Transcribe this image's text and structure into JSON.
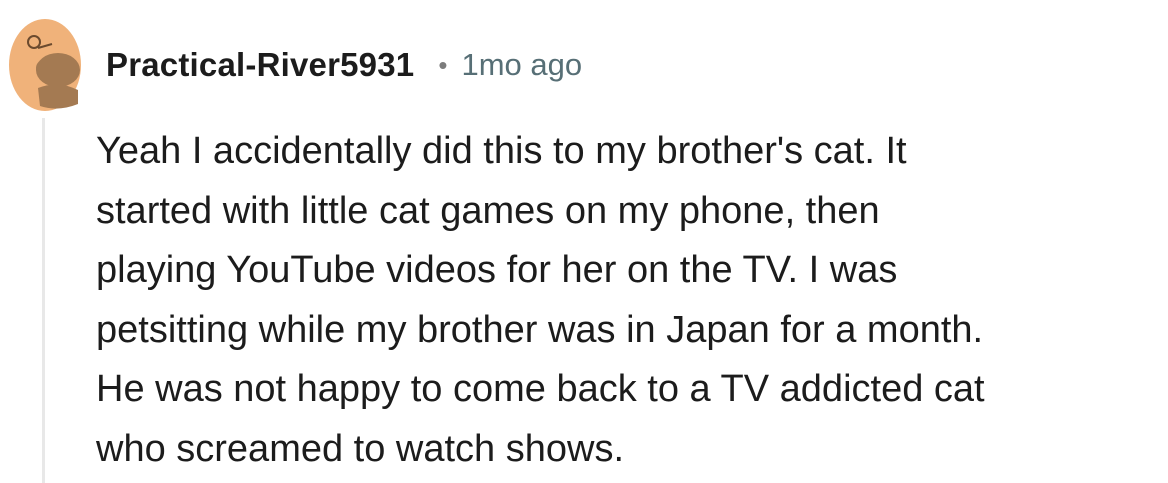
{
  "comment": {
    "avatar_icon": "snoo-avatar-icon",
    "author": "Practical-River5931",
    "separator": "•",
    "timestamp": "1mo ago",
    "body_lines": [
      "Yeah I accidentally did this to my brother's cat. It",
      "started with little cat games on my phone, then",
      "playing YouTube videos for her on the TV. I was",
      "petsitting while my brother was in Japan for a month.",
      "He was not happy to come back to a TV addicted cat",
      "who screamed to watch shows."
    ]
  },
  "colors": {
    "avatar_bg": "#f0b27a",
    "avatar_figure": "#a47a52",
    "thread_line": "#e8e8e8",
    "timestamp": "#576f76"
  }
}
